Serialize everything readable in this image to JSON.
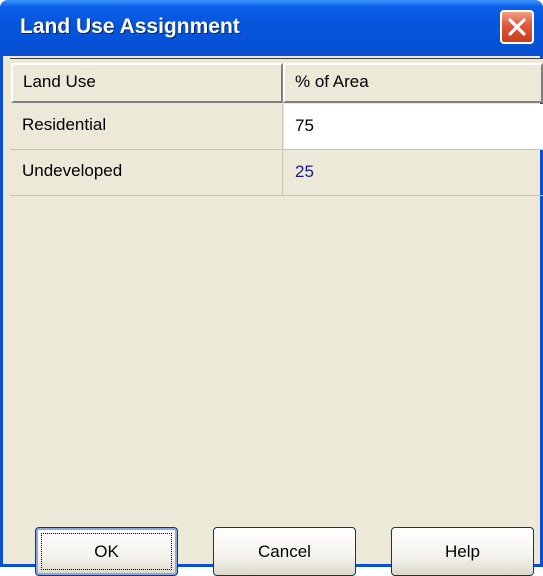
{
  "window": {
    "title": "Land Use Assignment"
  },
  "grid": {
    "columns": [
      "Land Use",
      "% of Area"
    ],
    "rows": [
      {
        "land_use": "Residential",
        "percent": "75"
      },
      {
        "land_use": "Undeveloped",
        "percent": "25"
      }
    ]
  },
  "buttons": {
    "ok": "OK",
    "cancel": "Cancel",
    "help": "Help"
  },
  "colors": {
    "titlebar": "#0655dc",
    "dialog_bg": "#ece9d8",
    "close_button": "#e0573a",
    "value_text": "#1a1a8a"
  },
  "icons": {
    "close": "close-icon"
  }
}
